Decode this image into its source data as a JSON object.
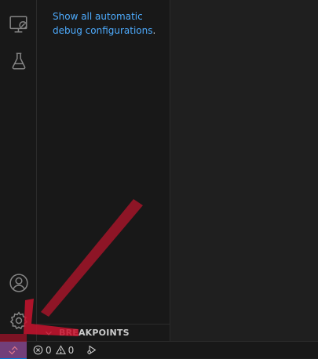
{
  "sidebar": {
    "link_text": "Show all automatic debug configurations",
    "link_period": ".",
    "section_title": "BREAKPOINTS"
  },
  "activity_bar": {
    "icons": [
      "remote-explorer-icon",
      "testing-flask-icon",
      "accounts-icon",
      "manage-gear-icon"
    ]
  },
  "status_bar": {
    "errors": "0",
    "warnings": "0"
  },
  "colors": {
    "accent": "#0078d4",
    "link": "#4daafc",
    "annotation_arrow": "#b0142a"
  }
}
